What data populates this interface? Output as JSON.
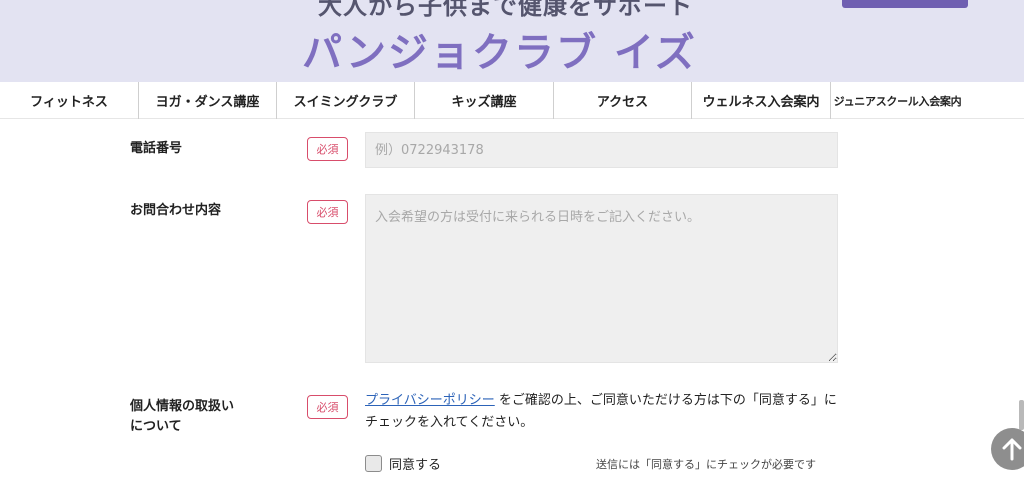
{
  "header": {
    "tagline": "大人から子供まで健康をサポート",
    "brand": "パンジョクラブ イズ"
  },
  "nav": {
    "items": [
      {
        "label": "フィットネス"
      },
      {
        "label": "ヨガ・ダンス講座"
      },
      {
        "label": "スイミングクラブ"
      },
      {
        "label": "キッズ講座"
      },
      {
        "label": "アクセス"
      },
      {
        "label": "ウェルネス入会案内"
      },
      {
        "label": "ジュニアスクール入会案内"
      }
    ]
  },
  "form": {
    "phone": {
      "label": "電話番号",
      "required": "必須",
      "placeholder": "例）0722943178",
      "value": ""
    },
    "inquiry": {
      "label": "お問合わせ内容",
      "required": "必須",
      "placeholder": "入会希望の方は受付に来られる日時をご記入ください。",
      "value": ""
    },
    "privacy": {
      "label_line1": "個人情報の取扱い",
      "label_line2": "について",
      "required": "必須",
      "link_text": "プライバシーポリシー",
      "text": "をご確認の上、ご同意いただける方は下の「同意する」にチェックを入れてください。",
      "agree_label": "同意する",
      "agree_checked": false,
      "note": "送信には「同意する」にチェックが必要です"
    }
  },
  "colors": {
    "header_bg": "#e3e3f2",
    "brand": "#7f6fc0",
    "required": "#d84d6b",
    "link": "#2c63b8"
  },
  "icons": {
    "scroll_top": "arrow-up-icon"
  }
}
